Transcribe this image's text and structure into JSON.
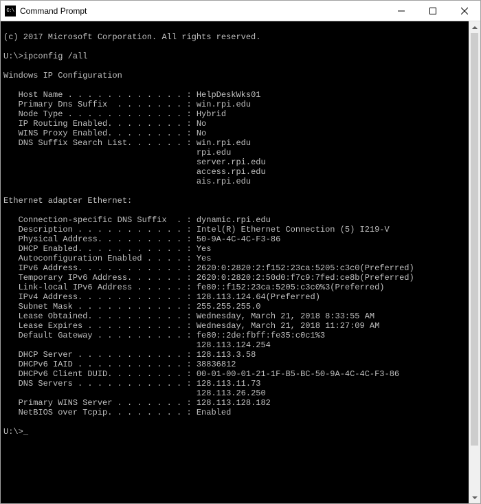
{
  "window": {
    "title": "Command Prompt"
  },
  "copyright": "(c) 2017 Microsoft Corporation. All rights reserved.",
  "prompt1": "U:\\>",
  "command1": "ipconfig /all",
  "section_ipconfig": "Windows IP Configuration",
  "host_name_label": "   Host Name . . . . . . . . . . . . : ",
  "host_name_value": "HelpDeskWks01",
  "primary_dns_suffix_label": "   Primary Dns Suffix  . . . . . . . : ",
  "primary_dns_suffix_value": "win.rpi.edu",
  "node_type_label": "   Node Type . . . . . . . . . . . . : ",
  "node_type_value": "Hybrid",
  "ip_routing_label": "   IP Routing Enabled. . . . . . . . : ",
  "ip_routing_value": "No",
  "wins_proxy_label": "   WINS Proxy Enabled. . . . . . . . : ",
  "wins_proxy_value": "No",
  "dns_search_label": "   DNS Suffix Search List. . . . . . : ",
  "dns_search_value0": "win.rpi.edu",
  "dns_search_indent": "                                       ",
  "dns_search_value1": "rpi.edu",
  "dns_search_value2": "server.rpi.edu",
  "dns_search_value3": "access.rpi.edu",
  "dns_search_value4": "ais.rpi.edu",
  "section_adapter": "Ethernet adapter Ethernet:",
  "conn_suffix_label": "   Connection-specific DNS Suffix  . : ",
  "conn_suffix_value": "dynamic.rpi.edu",
  "description_label": "   Description . . . . . . . . . . . : ",
  "description_value": "Intel(R) Ethernet Connection (5) I219-V",
  "phys_addr_label": "   Physical Address. . . . . . . . . : ",
  "phys_addr_value": "50-9A-4C-4C-F3-86",
  "dhcp_enabled_label": "   DHCP Enabled. . . . . . . . . . . : ",
  "dhcp_enabled_value": "Yes",
  "autoconf_label": "   Autoconfiguration Enabled . . . . : ",
  "autoconf_value": "Yes",
  "ipv6_label": "   IPv6 Address. . . . . . . . . . . : ",
  "ipv6_value": "2620:0:2820:2:f152:23ca:5205:c3c0(Preferred)",
  "temp_ipv6_label": "   Temporary IPv6 Address. . . . . . : ",
  "temp_ipv6_value": "2620:0:2820:2:50d0:f7c9:7fed:ce8b(Preferred)",
  "link_local_label": "   Link-local IPv6 Address . . . . . : ",
  "link_local_value": "fe80::f152:23ca:5205:c3c0%3(Preferred)",
  "ipv4_label": "   IPv4 Address. . . . . . . . . . . : ",
  "ipv4_value": "128.113.124.64(Preferred)",
  "subnet_label": "   Subnet Mask . . . . . . . . . . . : ",
  "subnet_value": "255.255.255.0",
  "lease_obtained_label": "   Lease Obtained. . . . . . . . . . : ",
  "lease_obtained_value": "Wednesday, March 21, 2018 8:33:55 AM",
  "lease_expires_label": "   Lease Expires . . . . . . . . . . : ",
  "lease_expires_value": "Wednesday, March 21, 2018 11:27:09 AM",
  "gateway_label": "   Default Gateway . . . . . . . . . : ",
  "gateway_value0": "fe80::2de:fbff:fe35:c0c1%3",
  "gateway_indent": "                                       ",
  "gateway_value1": "128.113.124.254",
  "dhcp_server_label": "   DHCP Server . . . . . . . . . . . : ",
  "dhcp_server_value": "128.113.3.58",
  "dhcpv6_iaid_label": "   DHCPv6 IAID . . . . . . . . . . . : ",
  "dhcpv6_iaid_value": "38836812",
  "dhcpv6_duid_label": "   DHCPv6 Client DUID. . . . . . . . : ",
  "dhcpv6_duid_value": "00-01-00-01-21-1F-B5-BC-50-9A-4C-4C-F3-86",
  "dns_servers_label": "   DNS Servers . . . . . . . . . . . : ",
  "dns_servers_value0": "128.113.11.73",
  "dns_servers_indent": "                                       ",
  "dns_servers_value1": "128.113.26.250",
  "wins_server_label": "   Primary WINS Server . . . . . . . : ",
  "wins_server_value": "128.113.128.182",
  "netbios_label": "   NetBIOS over Tcpip. . . . . . . . : ",
  "netbios_value": "Enabled",
  "prompt2": "U:\\>",
  "cursor": "_"
}
